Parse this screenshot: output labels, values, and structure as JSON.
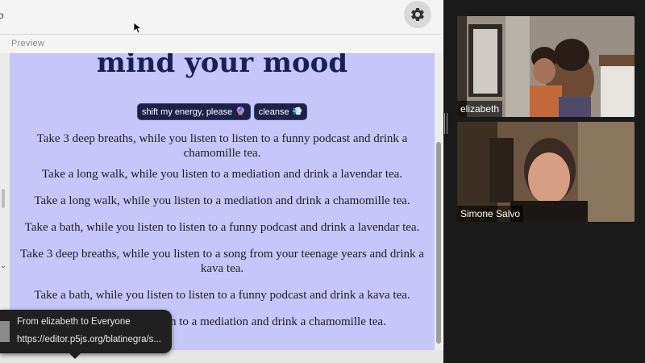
{
  "editor": {
    "top_fragment": "o",
    "preview_label": "Preview",
    "gutter_mark": "⌄"
  },
  "preview": {
    "title": "mind your mood",
    "buttons": [
      {
        "label": "shift my energy, please",
        "emoji": "🔮"
      },
      {
        "label": "cleanse",
        "emoji": "💨"
      }
    ],
    "paragraphs": [
      "Take 3 deep breaths, while you listen to listen to a funny podcast and drink a chamomille tea.",
      "Take a long walk, while you listen to a mediation and drink a lavendar tea.",
      "Take a long walk, while you listen to a mediation and drink a chamomille tea.",
      "Take a bath, while you listen to listen to a funny podcast and drink a lavendar tea.",
      "Take 3 deep breaths, while you listen to a song from your teenage years and drink a kava tea.",
      "Take a bath, while you listen to listen to a funny podcast and drink a kava tea.",
      "listen to a mediation and drink a chamomille tea."
    ]
  },
  "chat_toast": {
    "from": "From elizabeth to Everyone",
    "message": "https://editor.p5js.org/blatinegra/s..."
  },
  "participants": [
    {
      "name": "elizabeth"
    },
    {
      "name": "Simone Salvo"
    }
  ],
  "colors": {
    "canvas_bg": "#c6c6fb",
    "title": "#1c1f54",
    "pill_bg": "#1d2148",
    "call_bg": "#1a1a1a"
  }
}
